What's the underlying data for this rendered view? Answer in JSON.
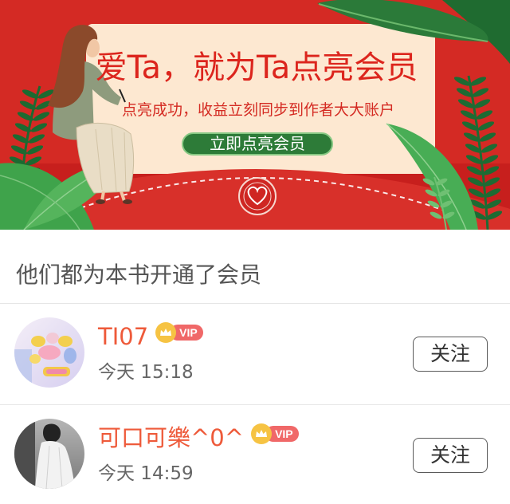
{
  "banner": {
    "title": "爱Ta，就为Ta点亮会员",
    "subtitle": "点亮成功，收益立刻同步到作者大大账户",
    "button_label": "立即点亮会员",
    "seal_icon": "heart-seal-icon"
  },
  "section_title": "他们都为本书开通了会员",
  "members": [
    {
      "name": "TI07",
      "vip_icon": "crown-icon",
      "vip_label": "VIP",
      "time": "今天 15:18",
      "follow_label": "关注"
    },
    {
      "name": "可口可樂^0^",
      "vip_icon": "crown-icon",
      "vip_label": "VIP",
      "time": "今天 14:59",
      "follow_label": "关注"
    }
  ],
  "colors": {
    "accent": "#dc251d",
    "name-color": "#ee5a3a",
    "button-green": "#2d7b38",
    "vip-pill": "#f06868",
    "crown-gold": "#f6c343",
    "text-gray": "#666666"
  }
}
